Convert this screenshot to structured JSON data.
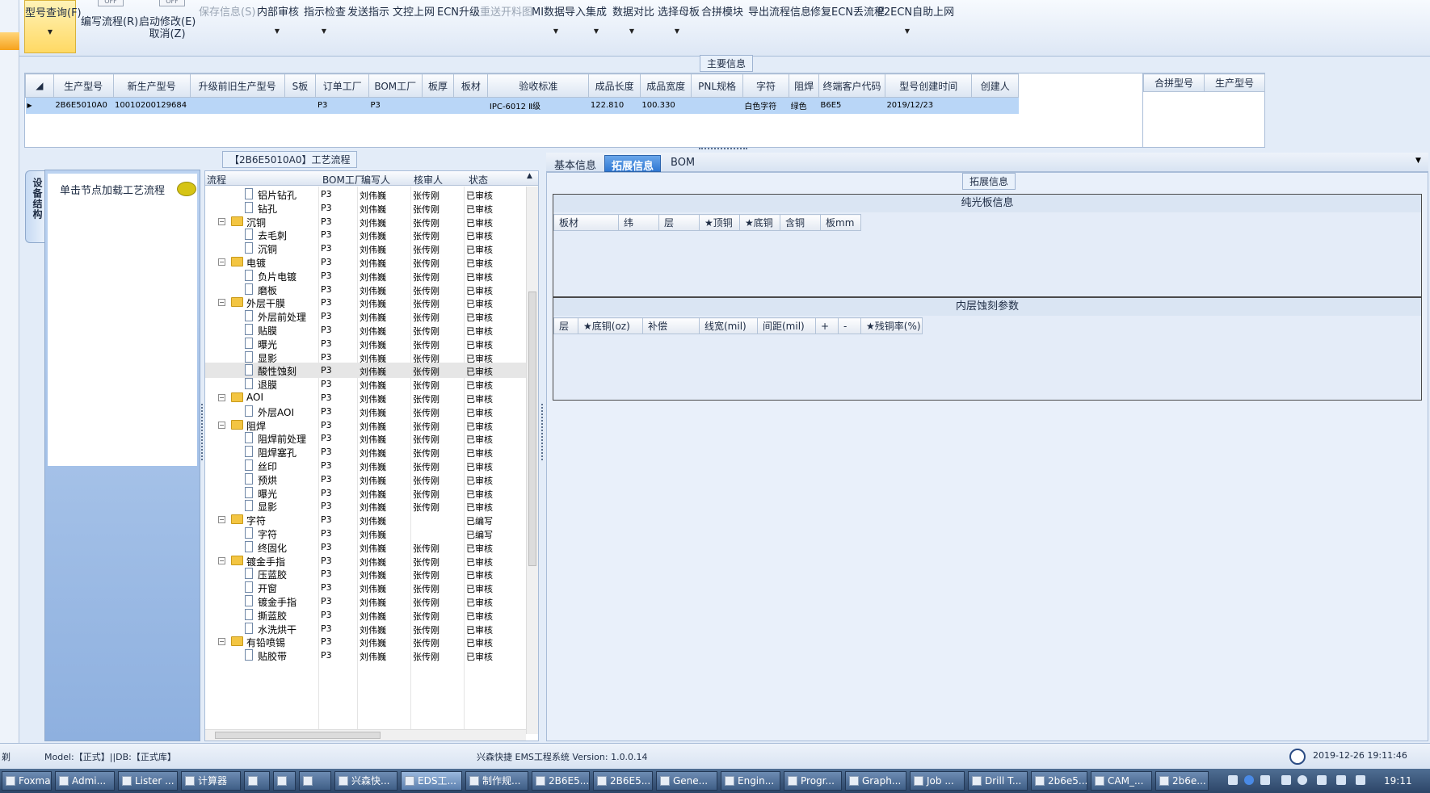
{
  "toolbar": {
    "buttons": [
      {
        "label": "型号查询(F)",
        "dropdown": true,
        "state": "active"
      },
      {
        "label": "编写流程(R)",
        "toggle": "OFF"
      },
      {
        "label": "启动修改(E)",
        "label2": "取消(Z)",
        "toggle": "OFF"
      },
      {
        "label": "保存信息(S)",
        "state": "disabled"
      },
      {
        "label": "内部审核",
        "dropdown": true
      },
      {
        "label": "指示检查",
        "dropdown": true
      },
      {
        "label": "发送指示"
      },
      {
        "label": "文控上网"
      },
      {
        "label": "ECN升级"
      },
      {
        "label": "重送开料图",
        "state": "disabled"
      },
      {
        "label": "MI数据导入",
        "dropdown": true
      },
      {
        "label": "集成",
        "dropdown": true
      },
      {
        "label": "数据对比",
        "dropdown": true
      },
      {
        "label": "选择母板",
        "dropdown": true
      },
      {
        "label": "合拼模块"
      },
      {
        "label": "导出流程信息"
      },
      {
        "label": "修复ECN丢流程"
      },
      {
        "label": "P2ECN自助上网",
        "dropdown": true
      }
    ]
  },
  "main_info": {
    "title": "主要信息",
    "columns": [
      "生产型号",
      "新生产型号",
      "升级前旧生产型号",
      "S板",
      "订单工厂",
      "BOM工厂",
      "板厚",
      "板材",
      "验收标准",
      "成品长度",
      "成品宽度",
      "PNL规格",
      "字符",
      "阻焊",
      "终端客户代码",
      "型号创建时间",
      "创建人"
    ],
    "rows": [
      [
        "2B6E5010A0",
        "10010200129684",
        "",
        "",
        "P3",
        "P3",
        "",
        "",
        "IPC-6012 Ⅱ级",
        "122.810",
        "100.330",
        "",
        "白色字符",
        "绿色",
        "B6E5",
        "2019/12/23",
        ""
      ]
    ],
    "merge_columns": [
      "合拼型号",
      "生产型号"
    ]
  },
  "side_panel": {
    "tab_label": "设备结构",
    "hint": "单击节点加载工艺流程"
  },
  "process_tree": {
    "title": "【2B6E5010A0】工艺流程",
    "columns": [
      "流程",
      "BOM工厂",
      "编写人",
      "核审人",
      "状态"
    ],
    "nodes": [
      {
        "level": 1,
        "name": "铝片钻孔",
        "factory": "P3",
        "writer": "刘伟巍",
        "reviewer": "张传刚",
        "status": "已审核"
      },
      {
        "level": 1,
        "name": "钻孔",
        "factory": "P3",
        "writer": "刘伟巍",
        "reviewer": "张传刚",
        "status": "已审核"
      },
      {
        "level": 0,
        "name": "沉铜",
        "factory": "P3",
        "writer": "刘伟巍",
        "reviewer": "张传刚",
        "status": "已审核"
      },
      {
        "level": 1,
        "name": "去毛刺",
        "factory": "P3",
        "writer": "刘伟巍",
        "reviewer": "张传刚",
        "status": "已审核"
      },
      {
        "level": 1,
        "name": "沉铜",
        "factory": "P3",
        "writer": "刘伟巍",
        "reviewer": "张传刚",
        "status": "已审核"
      },
      {
        "level": 0,
        "name": "电镀",
        "factory": "P3",
        "writer": "刘伟巍",
        "reviewer": "张传刚",
        "status": "已审核"
      },
      {
        "level": 1,
        "name": "负片电镀",
        "factory": "P3",
        "writer": "刘伟巍",
        "reviewer": "张传刚",
        "status": "已审核"
      },
      {
        "level": 1,
        "name": "磨板",
        "factory": "P3",
        "writer": "刘伟巍",
        "reviewer": "张传刚",
        "status": "已审核"
      },
      {
        "level": 0,
        "name": "外层干膜",
        "factory": "P3",
        "writer": "刘伟巍",
        "reviewer": "张传刚",
        "status": "已审核"
      },
      {
        "level": 1,
        "name": "外层前处理",
        "factory": "P3",
        "writer": "刘伟巍",
        "reviewer": "张传刚",
        "status": "已审核"
      },
      {
        "level": 1,
        "name": "贴膜",
        "factory": "P3",
        "writer": "刘伟巍",
        "reviewer": "张传刚",
        "status": "已审核"
      },
      {
        "level": 1,
        "name": "曝光",
        "factory": "P3",
        "writer": "刘伟巍",
        "reviewer": "张传刚",
        "status": "已审核"
      },
      {
        "level": 1,
        "name": "显影",
        "factory": "P3",
        "writer": "刘伟巍",
        "reviewer": "张传刚",
        "status": "已审核"
      },
      {
        "level": 1,
        "name": "酸性蚀刻",
        "factory": "P3",
        "writer": "刘伟巍",
        "reviewer": "张传刚",
        "status": "已审核",
        "selected": true
      },
      {
        "level": 1,
        "name": "退膜",
        "factory": "P3",
        "writer": "刘伟巍",
        "reviewer": "张传刚",
        "status": "已审核"
      },
      {
        "level": 0,
        "name": "AOI",
        "factory": "P3",
        "writer": "刘伟巍",
        "reviewer": "张传刚",
        "status": "已审核"
      },
      {
        "level": 1,
        "name": "外层AOI",
        "factory": "P3",
        "writer": "刘伟巍",
        "reviewer": "张传刚",
        "status": "已审核"
      },
      {
        "level": 0,
        "name": "阻焊",
        "factory": "P3",
        "writer": "刘伟巍",
        "reviewer": "张传刚",
        "status": "已审核"
      },
      {
        "level": 1,
        "name": "阻焊前处理",
        "factory": "P3",
        "writer": "刘伟巍",
        "reviewer": "张传刚",
        "status": "已审核"
      },
      {
        "level": 1,
        "name": "阻焊塞孔",
        "factory": "P3",
        "writer": "刘伟巍",
        "reviewer": "张传刚",
        "status": "已审核"
      },
      {
        "level": 1,
        "name": "丝印",
        "factory": "P3",
        "writer": "刘伟巍",
        "reviewer": "张传刚",
        "status": "已审核"
      },
      {
        "level": 1,
        "name": "预烘",
        "factory": "P3",
        "writer": "刘伟巍",
        "reviewer": "张传刚",
        "status": "已审核"
      },
      {
        "level": 1,
        "name": "曝光",
        "factory": "P3",
        "writer": "刘伟巍",
        "reviewer": "张传刚",
        "status": "已审核"
      },
      {
        "level": 1,
        "name": "显影",
        "factory": "P3",
        "writer": "刘伟巍",
        "reviewer": "张传刚",
        "status": "已审核"
      },
      {
        "level": 0,
        "name": "字符",
        "factory": "P3",
        "writer": "刘伟巍",
        "reviewer": "",
        "status": "已编写"
      },
      {
        "level": 1,
        "name": "字符",
        "factory": "P3",
        "writer": "刘伟巍",
        "reviewer": "",
        "status": "已编写"
      },
      {
        "level": 1,
        "name": "终固化",
        "factory": "P3",
        "writer": "刘伟巍",
        "reviewer": "张传刚",
        "status": "已审核"
      },
      {
        "level": 0,
        "name": "镀金手指",
        "factory": "P3",
        "writer": "刘伟巍",
        "reviewer": "张传刚",
        "status": "已审核"
      },
      {
        "level": 1,
        "name": "压蓝胶",
        "factory": "P3",
        "writer": "刘伟巍",
        "reviewer": "张传刚",
        "status": "已审核"
      },
      {
        "level": 1,
        "name": "开窗",
        "factory": "P3",
        "writer": "刘伟巍",
        "reviewer": "张传刚",
        "status": "已审核"
      },
      {
        "level": 1,
        "name": "镀金手指",
        "factory": "P3",
        "writer": "刘伟巍",
        "reviewer": "张传刚",
        "status": "已审核"
      },
      {
        "level": 1,
        "name": "撕蓝胶",
        "factory": "P3",
        "writer": "刘伟巍",
        "reviewer": "张传刚",
        "status": "已审核"
      },
      {
        "level": 1,
        "name": "水洗烘干",
        "factory": "P3",
        "writer": "刘伟巍",
        "reviewer": "张传刚",
        "status": "已审核"
      },
      {
        "level": 0,
        "name": "有铅喷锡",
        "factory": "P3",
        "writer": "刘伟巍",
        "reviewer": "张传刚",
        "status": "已审核"
      },
      {
        "level": 1,
        "name": "贴胶带",
        "factory": "P3",
        "writer": "刘伟巍",
        "reviewer": "张传刚",
        "status": "已审核"
      }
    ]
  },
  "detail": {
    "tabs": [
      "基本信息",
      "拓展信息",
      "BOM"
    ],
    "active_tab": "拓展信息",
    "group_title": "拓展信息",
    "sections": [
      {
        "title": "纯光板信息",
        "columns": [
          "板材",
          "纬",
          "层",
          "★顶铜",
          "★底铜",
          "含铜",
          "板mm"
        ]
      },
      {
        "title": "内层蚀刻参数",
        "columns": [
          "层",
          "★底铜(oz)",
          "补偿",
          "线宽(mil)",
          "间距(mil)",
          "+",
          "-",
          "★残铜率(%)"
        ]
      }
    ]
  },
  "statusbar": {
    "left_char": "剃",
    "model_db": "Model:【正式】||DB:【正式库】",
    "app_version": "兴森快捷 EMS工程系统 Version: 1.0.0.14",
    "datetime": "2019-12-26 19:11:46"
  },
  "taskbar": {
    "items": [
      {
        "label": "Foxmail"
      },
      {
        "label": "Admi..."
      },
      {
        "label": "Lister ..."
      },
      {
        "label": "计算器"
      },
      {
        "label": ""
      },
      {
        "label": ""
      },
      {
        "label": ""
      },
      {
        "label": "兴森快..."
      },
      {
        "label": "EDS工...",
        "active": true
      },
      {
        "label": "制作规..."
      },
      {
        "label": "2B6E5..."
      },
      {
        "label": "2B6E5..."
      },
      {
        "label": "Gene..."
      },
      {
        "label": "Engin..."
      },
      {
        "label": "Progr..."
      },
      {
        "label": "Graph..."
      },
      {
        "label": "Job ..."
      },
      {
        "label": "Drill T..."
      },
      {
        "label": "2b6e5..."
      },
      {
        "label": "CAM_..."
      },
      {
        "label": "2b6e..."
      }
    ],
    "clock": "19:11"
  }
}
